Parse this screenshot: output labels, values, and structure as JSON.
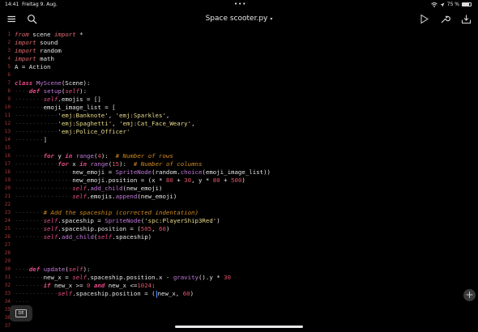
{
  "status_bar": {
    "time": "14:41",
    "date": "Freitag 9. Aug.",
    "center_indicator": "•••",
    "battery_text": "75 %",
    "battery_level": 0.75,
    "wifi_icon": "wifi-icon",
    "signal_icon": "location-icon"
  },
  "toolbar": {
    "title": "Space scooter.py",
    "title_caret": "▾",
    "left_icons": [
      "hamburger-menu-icon",
      "search-icon"
    ],
    "right_icons": [
      "run-play-icon",
      "wrench-icon",
      "share-tray-icon"
    ]
  },
  "editor": {
    "line_numbers": [
      "1",
      "2",
      "3",
      "4",
      "5",
      "6",
      "7",
      "8",
      "9",
      "10",
      "11",
      "12",
      "13",
      "14",
      "15",
      "16",
      "17",
      "18",
      "19",
      "20",
      "21",
      "22",
      "23",
      "24",
      "25",
      "26",
      "27",
      "28",
      "29",
      "30",
      "31",
      "32",
      "33",
      "34",
      "35",
      "36",
      "37"
    ],
    "colors": {
      "keyword": "#e94d8a",
      "function": "#c479dd",
      "string": "#e8d98a",
      "number": "#e2556a",
      "comment": "#d08a1e",
      "line_number": "#b03a3a",
      "cursor": "#4a90ff"
    }
  },
  "keyboard_chip": {
    "label": "DE"
  },
  "add_button": {
    "label": "+"
  }
}
